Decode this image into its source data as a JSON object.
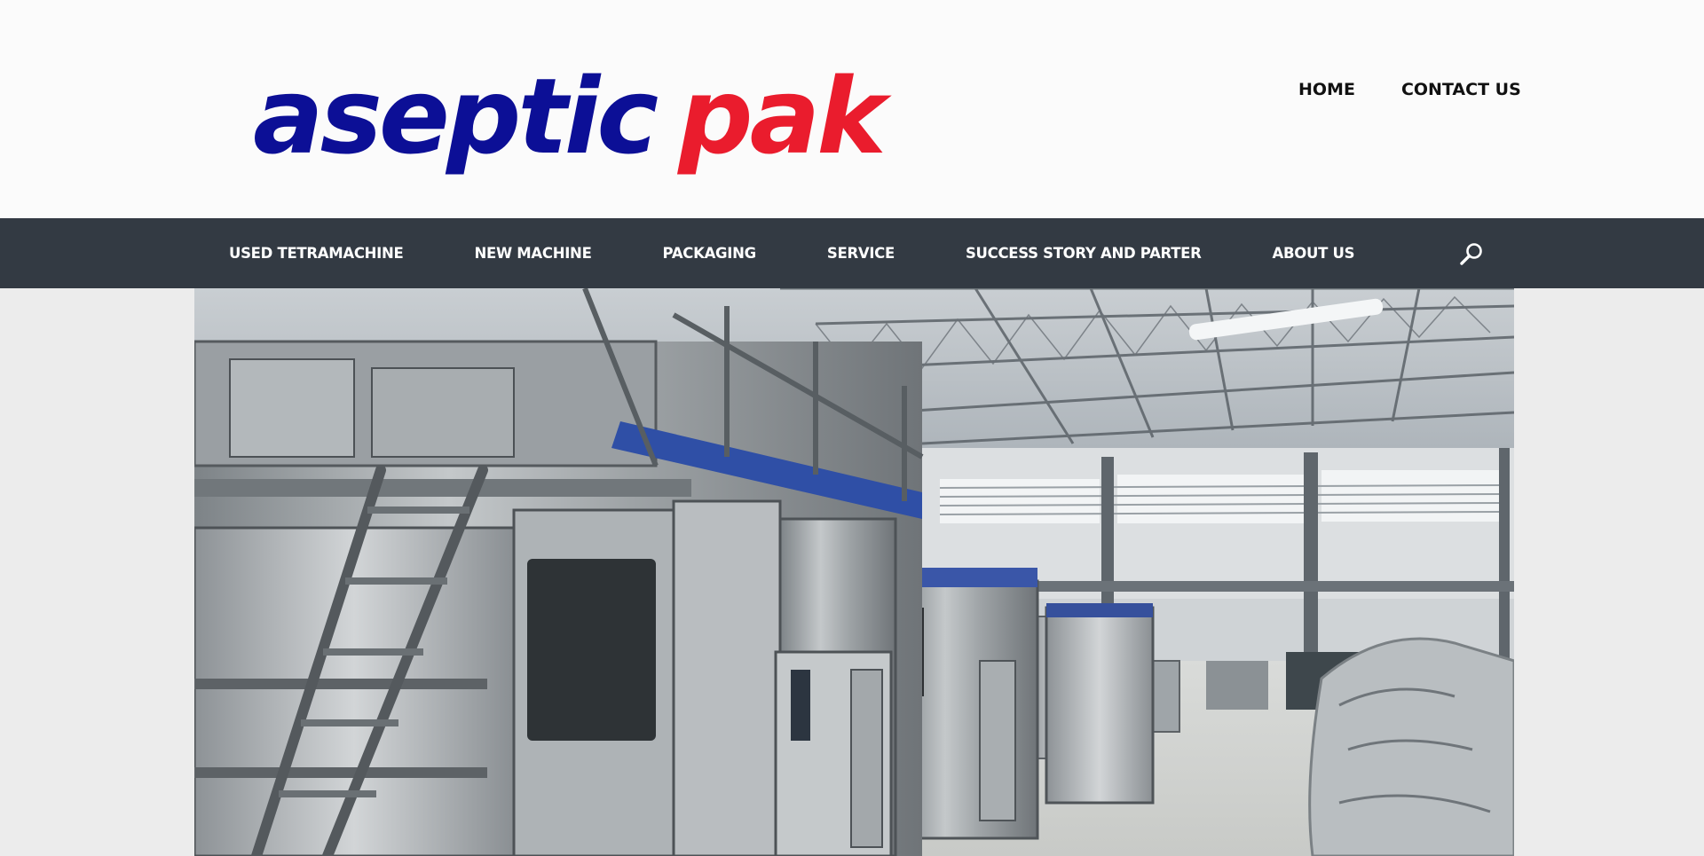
{
  "logo": {
    "word1": "aseptic",
    "word2": "pak",
    "color1": "#0c0f96",
    "color2": "#ea1c2d"
  },
  "top_nav": {
    "items": [
      "HOME",
      "CONTACT US"
    ]
  },
  "main_nav": {
    "items": [
      "USED TETRAMACHINE",
      "NEW MACHINE",
      "PACKAGING",
      "SERVICE",
      "SUCCESS STORY AND PARTER",
      "ABOUT US"
    ],
    "background": "#333a43"
  },
  "search": {
    "icon": "search-icon"
  },
  "hero": {
    "description_icon": "factory-image"
  }
}
